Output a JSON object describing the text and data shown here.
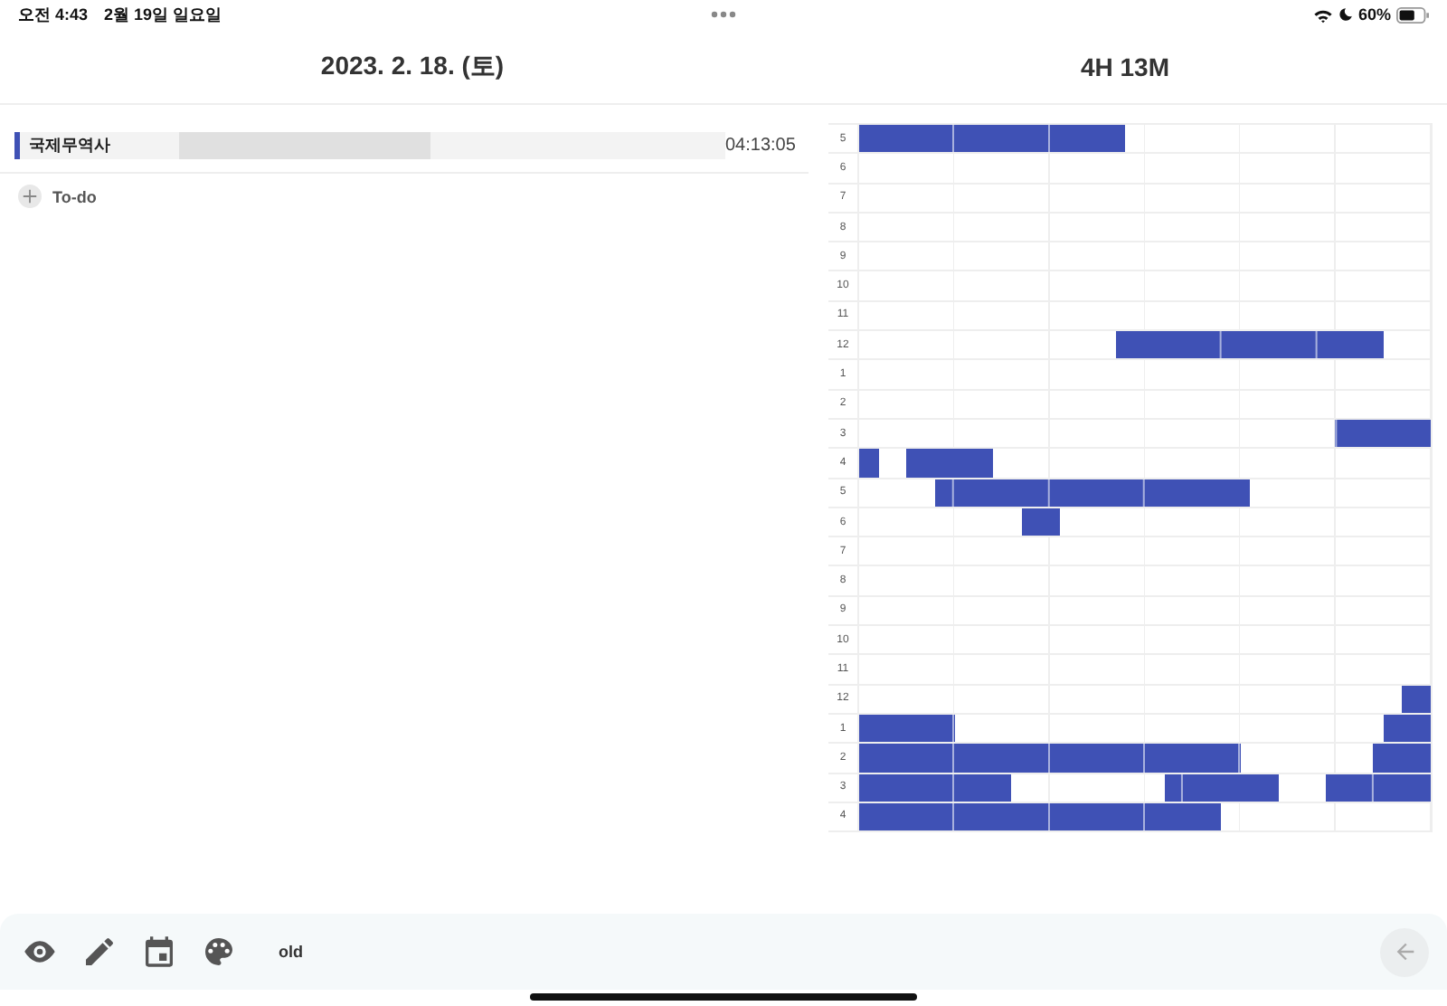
{
  "status_bar": {
    "time": "오전 4:43",
    "date": "2월 19일 일요일",
    "battery": "60%"
  },
  "header": {
    "date": "2023. 2. 18. (토)",
    "total": "4H 13M"
  },
  "tasks": [
    {
      "name": "국제무역사",
      "level": 0.46,
      "time": "04:13:05"
    }
  ],
  "add_todo": {
    "label": "To-do"
  },
  "timetable": {
    "hours": [
      "5",
      "6",
      "7",
      "8",
      "9",
      "10",
      "11",
      "12",
      "1",
      "2",
      "3",
      "4",
      "5",
      "6",
      "7",
      "8",
      "9",
      "10",
      "11",
      "12",
      "1",
      "2",
      "3",
      "4"
    ]
  },
  "toolbar": {
    "label": "old"
  }
}
